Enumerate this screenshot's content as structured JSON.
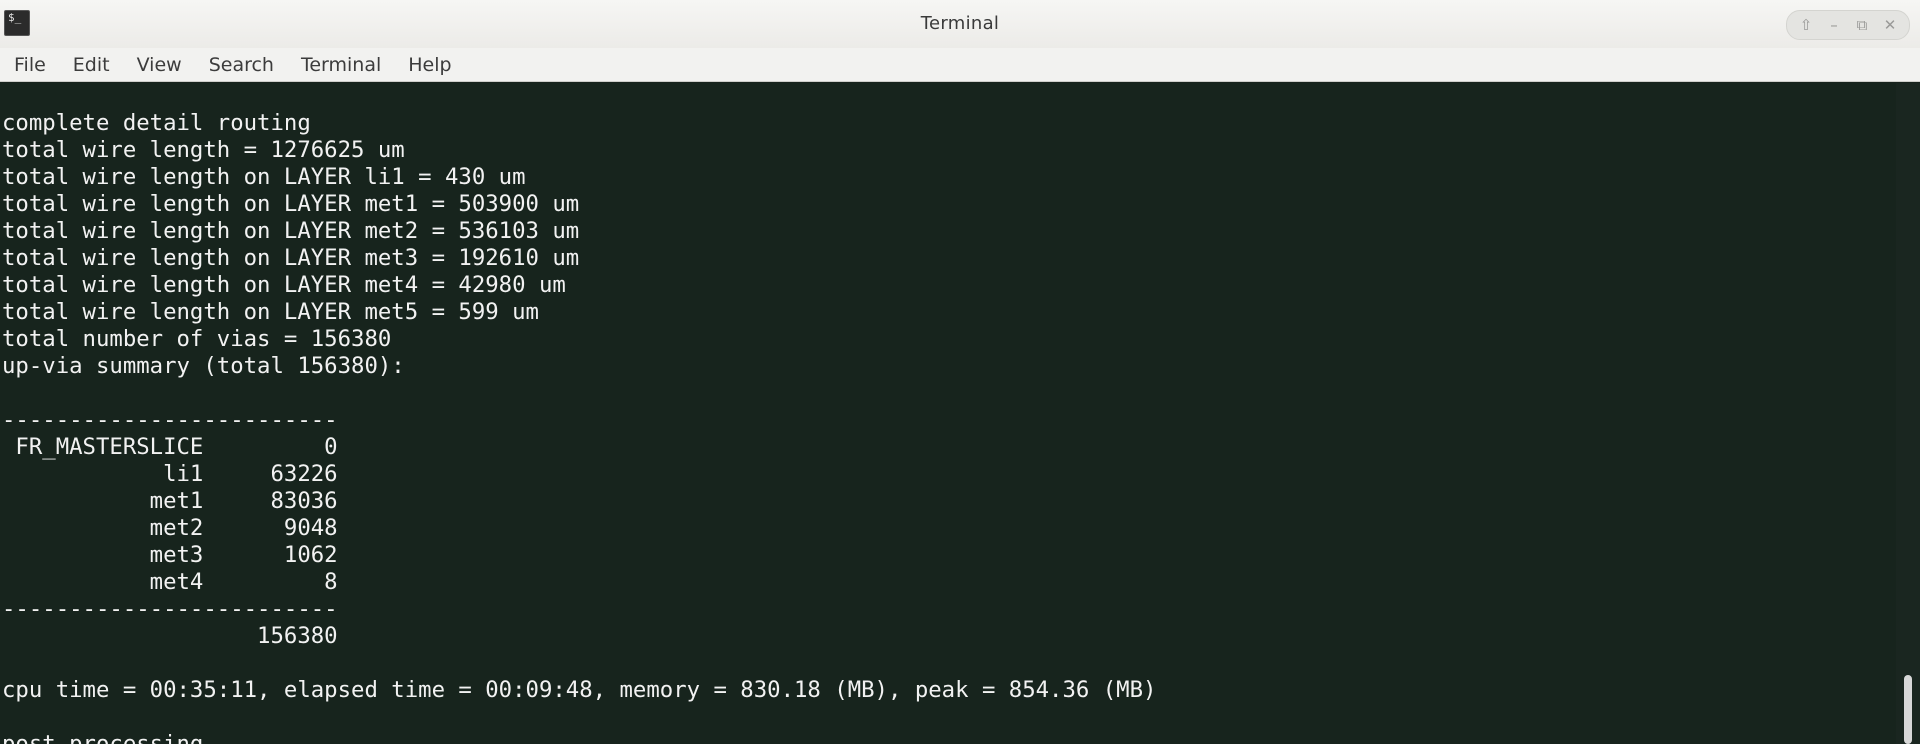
{
  "window": {
    "title": "Terminal",
    "app_icon": "terminal-icon",
    "app_icon_glyph": "$_",
    "controls": [
      {
        "name": "keep-above-icon",
        "glyph": "⇧"
      },
      {
        "name": "minimize-icon",
        "glyph": "–"
      },
      {
        "name": "maximize-icon",
        "glyph": "⧉"
      },
      {
        "name": "close-icon",
        "glyph": "✕"
      }
    ]
  },
  "menu": {
    "items": [
      "File",
      "Edit",
      "View",
      "Search",
      "Terminal",
      "Help"
    ]
  },
  "terminal": {
    "lines": [
      "complete detail routing",
      "total wire length = 1276625 um",
      "total wire length on LAYER li1 = 430 um",
      "total wire length on LAYER met1 = 503900 um",
      "total wire length on LAYER met2 = 536103 um",
      "total wire length on LAYER met3 = 192610 um",
      "total wire length on LAYER met4 = 42980 um",
      "total wire length on LAYER met5 = 599 um",
      "total number of vias = 156380",
      "up-via summary (total 156380):",
      "",
      "-------------------------",
      " FR_MASTERSLICE         0",
      "            li1     63226",
      "           met1     83036",
      "           met2      9048",
      "           met3      1062",
      "           met4         8",
      "-------------------------",
      "                   156380",
      "",
      "cpu time = 00:35:11, elapsed time = 00:09:48, memory = 830.18 (MB), peak = 854.36 (MB)",
      "",
      "post processing..."
    ]
  },
  "colors": {
    "terminal_bg": "#17241d",
    "terminal_fg": "#f2f2f2"
  }
}
